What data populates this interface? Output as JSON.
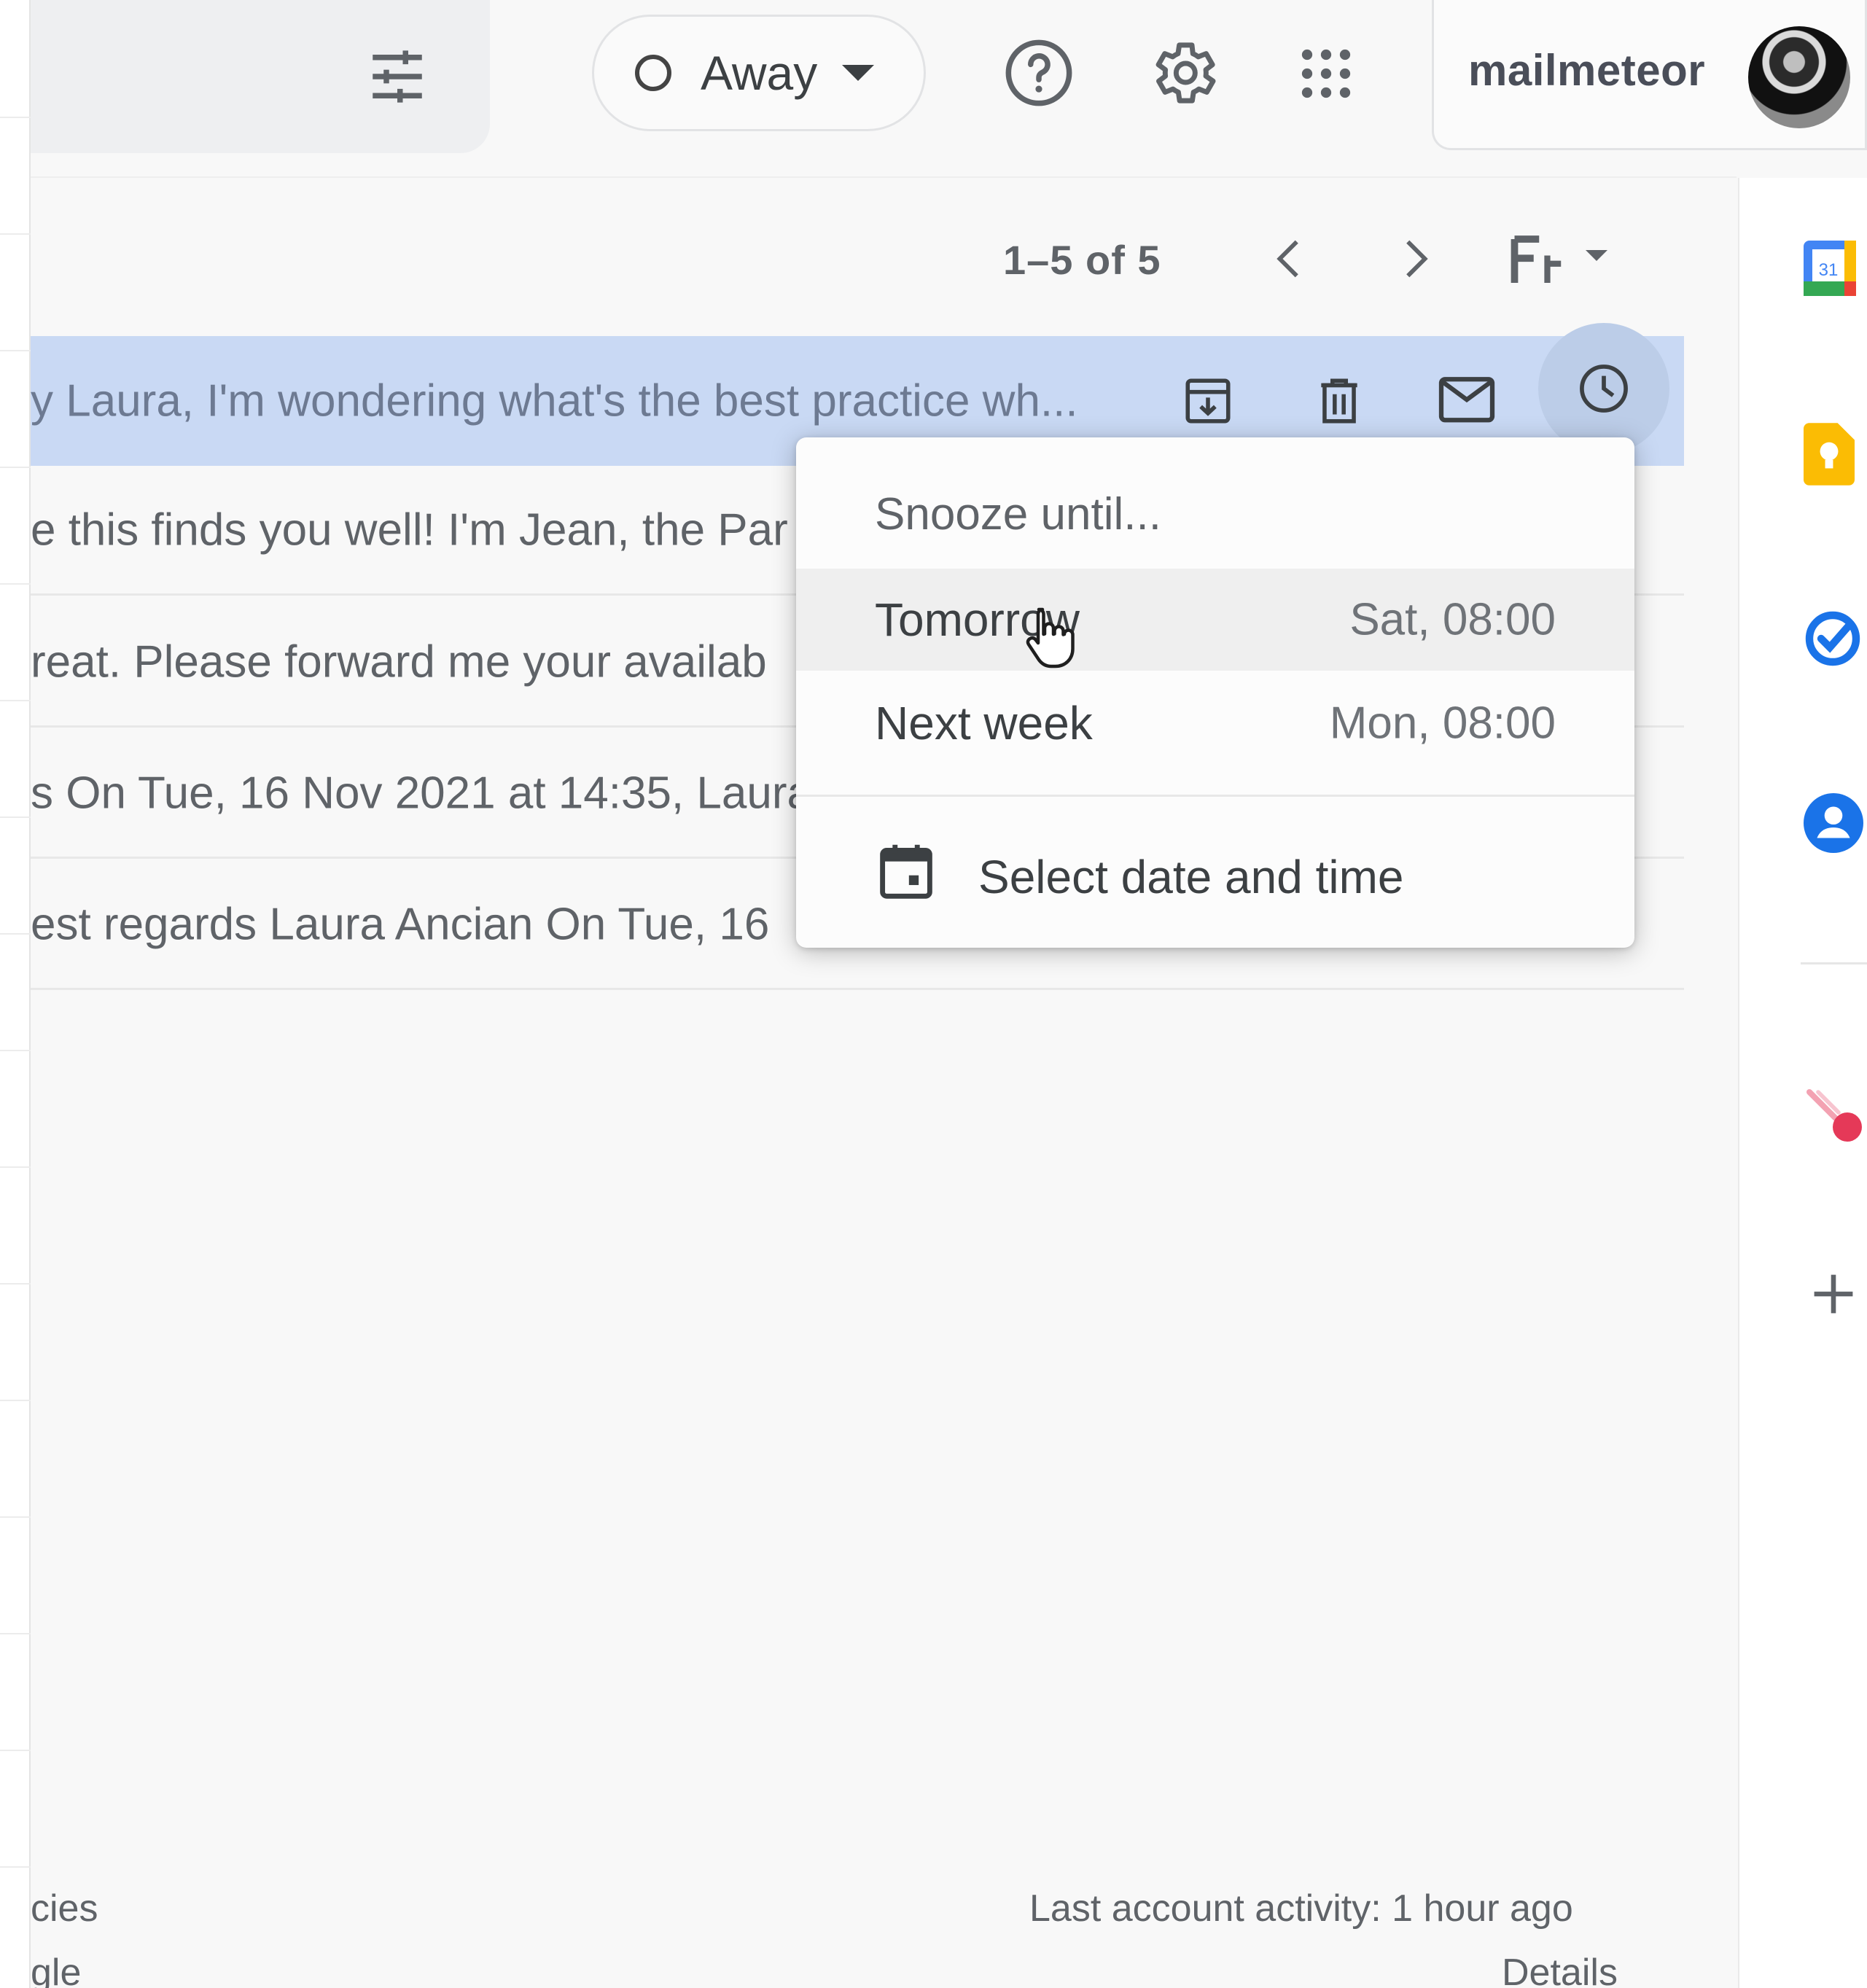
{
  "header": {
    "status": "Away",
    "account_name": "mailmeteor"
  },
  "toolbar": {
    "pager": "1–5 of 5"
  },
  "emails": [
    {
      "snippet": "y Laura, I'm wondering what's the best practice wh...",
      "selected": true
    },
    {
      "snippet": "e this finds you well! I'm Jean, the Par"
    },
    {
      "snippet": "reat. Please forward me your availab"
    },
    {
      "snippet": "s On Tue, 16 Nov 2021 at 14:35, Laura"
    },
    {
      "snippet": "est regards Laura Ancian On Tue, 16"
    }
  ],
  "snooze_menu": {
    "header": "Snooze until...",
    "items": [
      {
        "label": "Tomorrow",
        "time": "Sat, 08:00"
      },
      {
        "label": "Next week",
        "time": "Mon, 08:00"
      }
    ],
    "custom_label": "Select date and time"
  },
  "footer": {
    "left_line1": "cies",
    "left_line2": "gle",
    "activity": "Last account activity: 1 hour ago",
    "details": "Details"
  },
  "side_panel_icons": [
    "calendar-icon",
    "keep-icon",
    "tasks-icon",
    "contacts-icon",
    "mailmeteor-addon-icon",
    "add-addon-icon"
  ],
  "colors": {
    "selected_row": "#c9d9f4",
    "calendar_blue": "#4285f4",
    "keep_yellow": "#fbbc04",
    "tasks_blue": "#1a73e8",
    "contacts_blue": "#1a73e8",
    "addon_red": "#e53958"
  }
}
